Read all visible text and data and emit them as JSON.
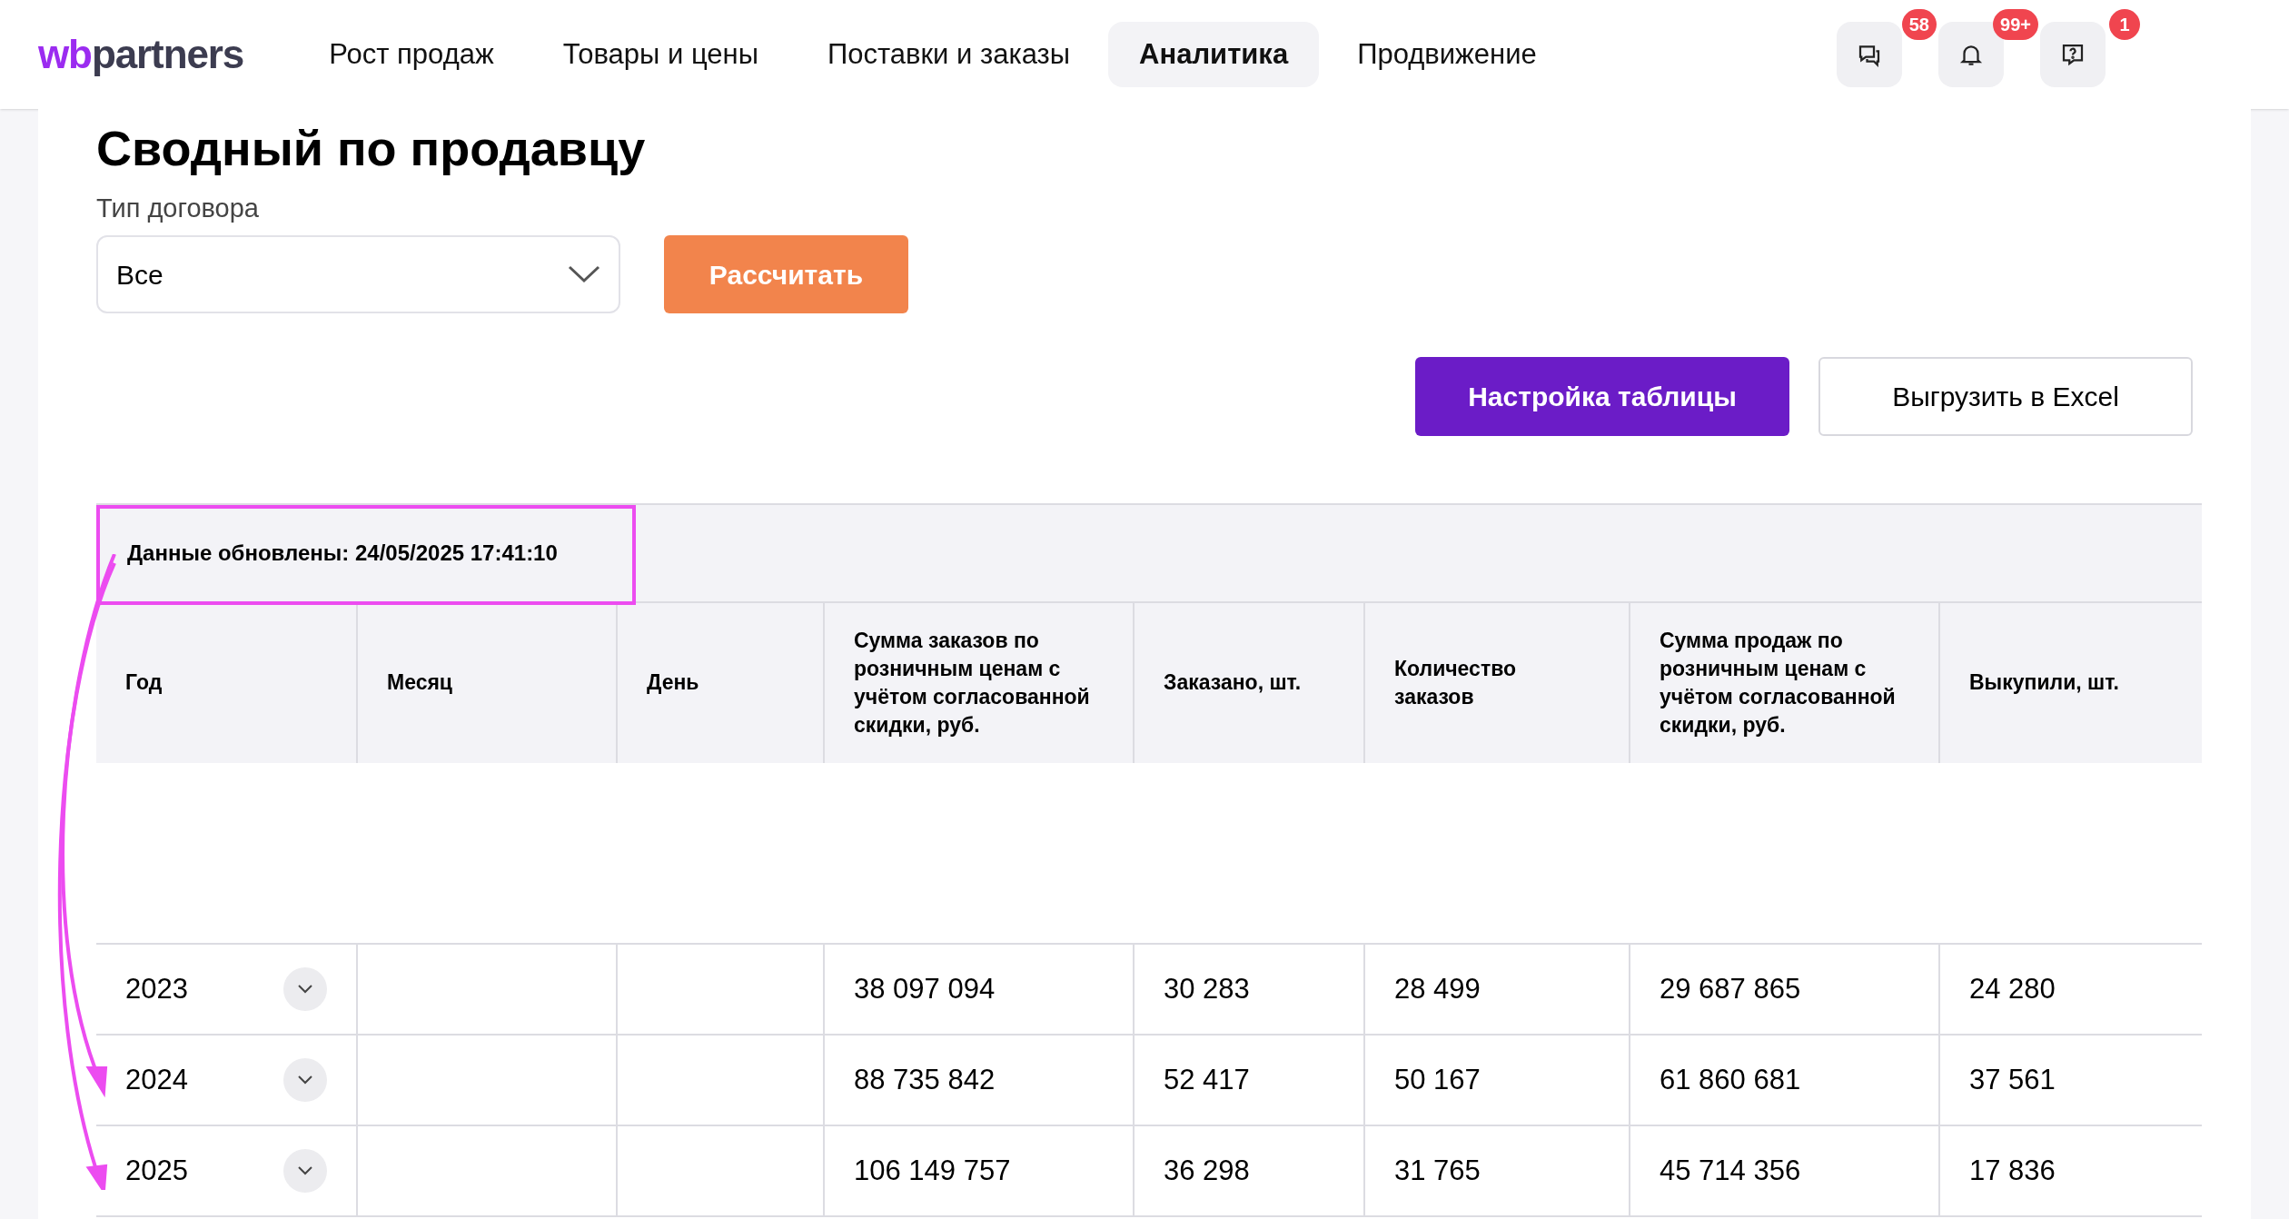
{
  "logo": {
    "accent": "wb",
    "rest": "partners"
  },
  "nav": [
    {
      "label": "Рост продаж",
      "selected": false
    },
    {
      "label": "Товары и цены",
      "selected": false
    },
    {
      "label": "Поставки и заказы",
      "selected": false
    },
    {
      "label": "Аналитика",
      "selected": true
    },
    {
      "label": "Продвижение",
      "selected": false
    }
  ],
  "header_icons": [
    {
      "kind": "chat",
      "badge": "58"
    },
    {
      "kind": "bell",
      "badge": "99+"
    },
    {
      "kind": "help",
      "badge": "1"
    }
  ],
  "page_title": "Сводный по продавцу",
  "contract_type": {
    "label": "Тип договора",
    "value": "Все"
  },
  "calculate_button": "Рассчитать",
  "table_settings_button": "Настройка таблицы",
  "export_button": "Выгрузить в Excel",
  "table": {
    "updated": "Данные обновлены: 24/05/2025 17:41:10",
    "columns": [
      "Год",
      "Месяц",
      "День",
      "Сумма заказов по розничным ценам с учётом согласованной скидки, руб.",
      "Заказано, шт.",
      "Количество заказов",
      "Сумма продаж по розничным ценам с учётом согласованной скидки, руб.",
      "Выкупили, шт."
    ],
    "rows": [
      {
        "expanded": false,
        "cells": [
          "2023",
          "",
          "",
          "38 097 094",
          "30 283",
          "28 499",
          "29 687 865",
          "24 280"
        ]
      },
      {
        "expanded": false,
        "cells": [
          "2024",
          "",
          "",
          "88 735 842",
          "52 417",
          "50 167",
          "61 860 681",
          "37 561"
        ]
      },
      {
        "expanded": false,
        "cells": [
          "2025",
          "",
          "",
          "106 149 757",
          "36 298",
          "31 765",
          "45 714 356",
          "17 836"
        ]
      }
    ]
  }
}
